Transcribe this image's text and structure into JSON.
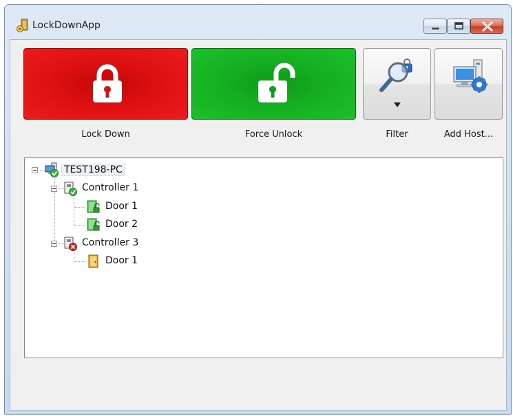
{
  "window": {
    "title": "LockDownApp"
  },
  "toolbar": {
    "lock_down_label": "Lock Down",
    "force_unlock_label": "Force Unlock",
    "filter_label": "Filter",
    "add_host_label": "Add Host..."
  },
  "tree": {
    "host": {
      "label": "TEST198-PC",
      "status": "online"
    },
    "controllers": [
      {
        "label": "Controller 1",
        "status": "ok",
        "doors": [
          {
            "label": "Door 1",
            "state": "unlocked"
          },
          {
            "label": "Door 2",
            "state": "unlocked"
          }
        ]
      },
      {
        "label": "Controller 3",
        "status": "error",
        "doors": [
          {
            "label": "Door 1",
            "state": "unknown"
          }
        ]
      }
    ]
  },
  "colors": {
    "lock_down": "#dd1010",
    "force_unlock": "#15ae22",
    "status_ok": "#3fb14a",
    "status_error": "#d9251d"
  }
}
